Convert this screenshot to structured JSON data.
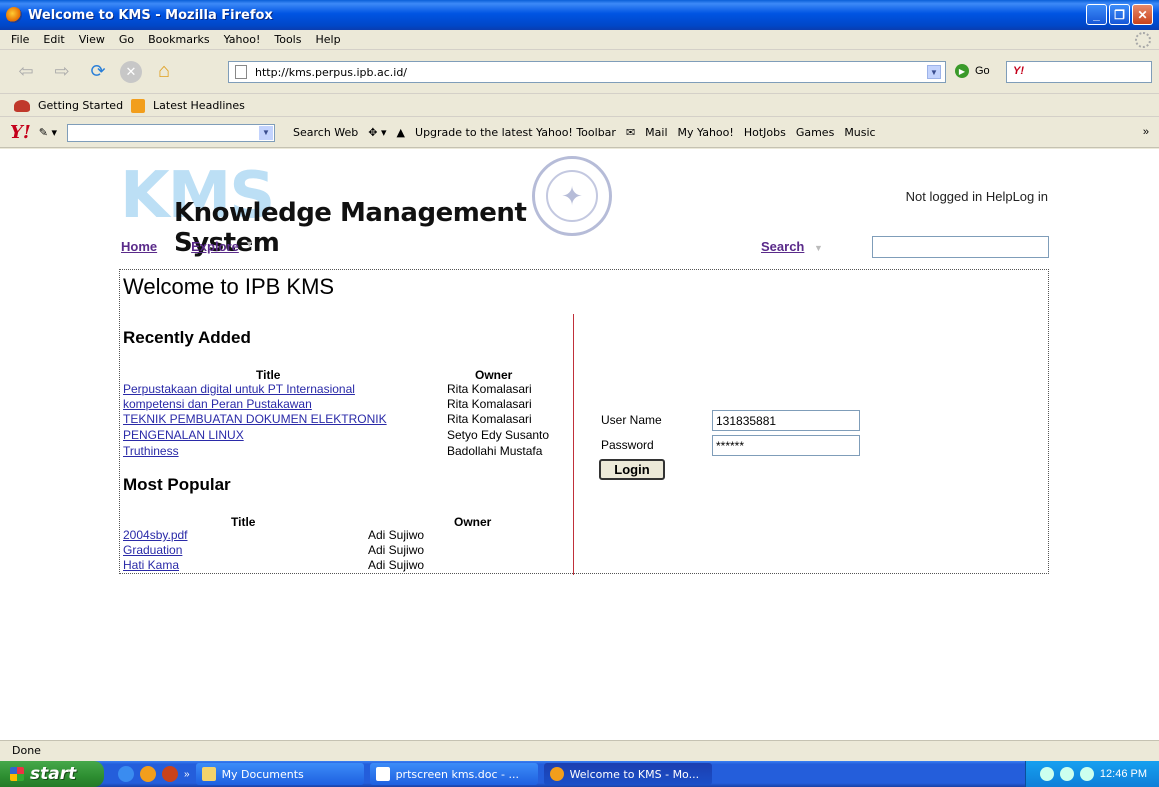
{
  "window": {
    "title": "Welcome to KMS - Mozilla Firefox"
  },
  "menu": [
    "File",
    "Edit",
    "View",
    "Go",
    "Bookmarks",
    "Yahoo!",
    "Tools",
    "Help"
  ],
  "nav": {
    "url": "http://kms.perpus.ipb.ac.id/",
    "go_label": "Go"
  },
  "bookmarks": {
    "getting_started": "Getting Started",
    "latest_headlines": "Latest Headlines"
  },
  "yahoo_toolbar": {
    "logo": "Y!",
    "search_web": "Search Web",
    "upgrade": "Upgrade to the latest Yahoo! Toolbar",
    "mail": "Mail",
    "my_yahoo": "My Yahoo!",
    "hotjobs": "HotJobs",
    "games": "Games",
    "music": "Music",
    "more": "»"
  },
  "page": {
    "logo_big": "KMS",
    "logo_sub": "Knowledge Management System",
    "login_links": "Not logged in HelpLog in",
    "nav_home": "Home",
    "nav_explore": "Explore",
    "nav_search": "Search",
    "welcome": "Welcome to IPB KMS",
    "recent": {
      "heading": "Recently Added",
      "col_title": "Title",
      "col_owner": "Owner",
      "rows": [
        {
          "title": "Perpustakaan digital untuk PT Internasional",
          "owner": "Rita Komalasari"
        },
        {
          "title": "kompetensi dan Peran Pustakawan",
          "owner": "Rita Komalasari"
        },
        {
          "title": "TEKNIK PEMBUATAN DOKUMEN ELEKTRONIK",
          "owner": "Rita Komalasari"
        },
        {
          "title": "PENGENALAN LINUX",
          "owner": "Setyo Edy Susanto"
        },
        {
          "title": "Truthiness",
          "owner": "Badollahi Mustafa"
        }
      ]
    },
    "popular": {
      "heading": "Most Popular",
      "col_title": "Title",
      "col_owner": "Owner",
      "rows": [
        {
          "title": "2004sby.pdf",
          "owner": "Adi Sujiwo"
        },
        {
          "title": "Graduation",
          "owner": "Adi Sujiwo"
        },
        {
          "title": "Hati Kama",
          "owner": "Adi Sujiwo"
        }
      ]
    },
    "login": {
      "username_label": "User Name",
      "username_value": "131835881",
      "password_label": "Password",
      "password_value": "******",
      "button": "Login"
    }
  },
  "status": "Done",
  "taskbar": {
    "start": "start",
    "items": [
      "My Documents",
      "prtscreen kms.doc - ...",
      "Welcome to KMS - Mo..."
    ],
    "clock": "12:46 PM"
  }
}
